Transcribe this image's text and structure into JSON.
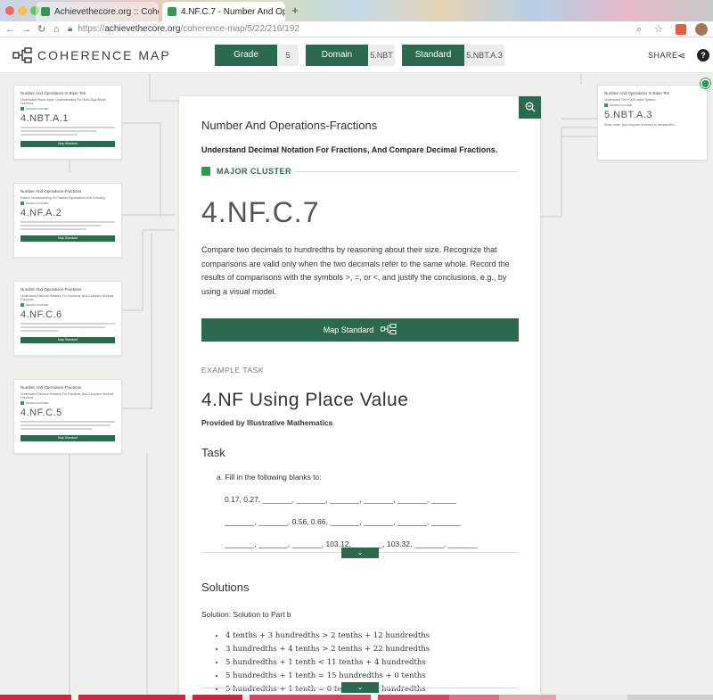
{
  "browser": {
    "tabs": [
      {
        "title": "Achievethecore.org :: Coherenc"
      },
      {
        "title": "4.NF.C.7 - Number And Operatio"
      }
    ],
    "url_prefix": "https://",
    "url_host": "achievethecore.org",
    "url_path": "/coherence-map/5/22/216/192"
  },
  "header": {
    "logo_text": "COHERENCE MAP",
    "filters": [
      {
        "label": "Grade",
        "value": "5"
      },
      {
        "label": "Domain",
        "value": "5.NBT"
      },
      {
        "label": "Standard",
        "value": "5.NBT.A.3"
      }
    ],
    "share_label": "SHARE",
    "help_label": "?"
  },
  "left_cards": [
    {
      "domain": "Number And Operations In Base Ten",
      "cluster": "Understand Place Value: Understanding For Multi-Digit Whole Numbers.",
      "tag": "MAJOR CLUSTER",
      "code": "4.NBT.A.1",
      "button": "Map Standard"
    },
    {
      "domain": "Number And Operations-Fractions",
      "cluster": "Extend Understanding Of Fraction Equivalence And Ordering.",
      "tag": "MAJOR CLUSTER",
      "code": "4.NF.A.2",
      "button": "Map Standard"
    },
    {
      "domain": "Number And Operations-Fractions",
      "cluster": "Understand Decimal Notation For Fractions, And Compare Decimal Fractions.",
      "tag": "MAJOR CLUSTER",
      "code": "4.NF.C.6",
      "button": "Map Standard"
    },
    {
      "domain": "Number And Operations-Fractions",
      "cluster": "Understand Decimal Notation For Fractions, And Compare Decimal Fractions.",
      "tag": "MAJOR CLUSTER",
      "code": "4.NF.C.5",
      "button": "Map Standard"
    }
  ],
  "right_card": {
    "domain": "Number And Operations In Base Ten",
    "cluster": "Understand The Place Value System.",
    "tag": "MAJOR CLUSTER",
    "code": "5.NBT.A.3",
    "desc": "Read, write, and compare decimals to thousandths."
  },
  "main": {
    "domain": "Number And Operations-Fractions",
    "cluster": "Understand Decimal Notation For Fractions, And Compare Decimal Fractions.",
    "cluster_tag": "MAJOR CLUSTER",
    "code": "4.NF.C.7",
    "description": "Compare two decimals to hundredths by reasoning about their size. Recognize that comparisons are valid only when the two decimals refer to the same whole. Record the results of comparisons with the symbols >, =, or <, and justify the conclusions, e.g., by using a visual model.",
    "map_button": "Map Standard",
    "example_label": "EXAMPLE TASK",
    "task_title": "4.NF Using Place Value",
    "provided_by": "Provided by Illustrative Mathematics",
    "task_heading": "Task",
    "task_item_a": "a. Fill in the following blanks to:",
    "blank_lines": [
      "0.17, 0.27, _______, _______, _______, _______, _______, ______",
      "_______, _______, 0.56, 0.66, _______, _______, _______, _______",
      "_______, _______, _______, 103.12, _______, 103.32, _______, _______"
    ],
    "solutions_heading": "Solutions",
    "solution_part": "Solution: Solution to Part b",
    "solution_items": [
      "4 tenths + 3 hundredths > 2 tenths + 12 hundredths",
      "3 hundredths + 4 tenths > 2 tenths + 22 hundredths",
      "5 hundredths + 1 tenth < 11 tenths + 4 hundredths",
      "5 hundredths + 1 tenth = 15 hundredths + 0 tenths",
      "5 hundredths + 1 tenth = 0 tenths + 15 hundredths"
    ]
  },
  "colors": {
    "accent": "#2b6a4f",
    "accent_light": "#2f9a55",
    "background": "#f0efec"
  }
}
